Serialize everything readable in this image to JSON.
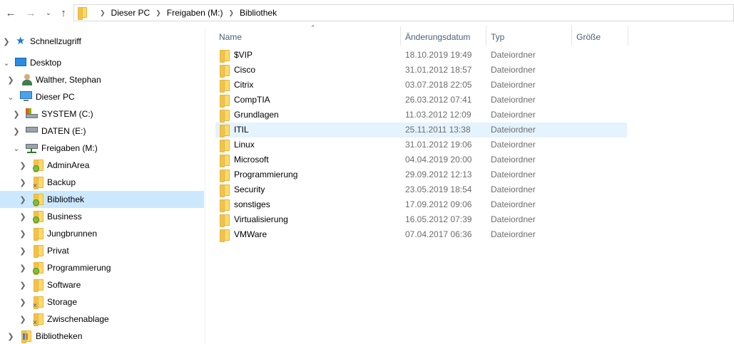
{
  "breadcrumb": [
    "Dieser PC",
    "Freigaben (M:)",
    "Bibliothek"
  ],
  "icons": {
    "back": "arrow-left-icon",
    "forward": "arrow-right-icon",
    "recent": "chevron-down-icon",
    "up": "arrow-up-icon"
  },
  "nav_tree": [
    {
      "label": "Schnellzugriff",
      "icon": "star-icon"
    },
    {
      "label": "Desktop",
      "icon": "desktop-icon"
    },
    {
      "label": "Walther, Stephan",
      "icon": "user-icon"
    },
    {
      "label": "Dieser PC",
      "icon": "computer-icon"
    },
    {
      "label": "SYSTEM (C:)",
      "icon": "system-drive-icon"
    },
    {
      "label": "DATEN (E:)",
      "icon": "drive-icon"
    },
    {
      "label": "Freigaben (M:)",
      "icon": "network-drive-icon"
    },
    {
      "label": "AdminArea",
      "icon": "shared-folder-icon"
    },
    {
      "label": "Backup",
      "icon": "offline-folder-icon"
    },
    {
      "label": "Bibliothek",
      "icon": "shared-folder-icon",
      "selected": true
    },
    {
      "label": "Business",
      "icon": "shared-folder-icon"
    },
    {
      "label": "Jungbrunnen",
      "icon": "folder-icon"
    },
    {
      "label": "Privat",
      "icon": "folder-icon"
    },
    {
      "label": "Programmierung",
      "icon": "shared-folder-icon"
    },
    {
      "label": "Software",
      "icon": "folder-icon"
    },
    {
      "label": "Storage",
      "icon": "offline-folder-icon"
    },
    {
      "label": "Zwischenablage",
      "icon": "offline-folder-icon"
    },
    {
      "label": "Bibliotheken",
      "icon": "libraries-icon"
    }
  ],
  "columns": {
    "name": "Name",
    "date": "Änderungsdatum",
    "type": "Typ",
    "size": "Größe"
  },
  "files": [
    {
      "name": "$VIP",
      "date": "18.10.2019 19:49",
      "type": "Dateiordner"
    },
    {
      "name": "Cisco",
      "date": "31.01.2012 18:57",
      "type": "Dateiordner"
    },
    {
      "name": "Citrix",
      "date": "03.07.2018 22:05",
      "type": "Dateiordner"
    },
    {
      "name": "CompTIA",
      "date": "26.03.2012 07:41",
      "type": "Dateiordner"
    },
    {
      "name": "Grundlagen",
      "date": "11.03.2012 12:09",
      "type": "Dateiordner"
    },
    {
      "name": "ITIL",
      "date": "25.11.2011 13:38",
      "type": "Dateiordner",
      "hover": true
    },
    {
      "name": "Linux",
      "date": "31.01.2012 19:06",
      "type": "Dateiordner"
    },
    {
      "name": "Microsoft",
      "date": "04.04.2019 20:00",
      "type": "Dateiordner"
    },
    {
      "name": "Programmierung",
      "date": "29.09.2012 12:13",
      "type": "Dateiordner"
    },
    {
      "name": "Security",
      "date": "23.05.2019 18:54",
      "type": "Dateiordner"
    },
    {
      "name": "sonstiges",
      "date": "17.09.2012 09:06",
      "type": "Dateiordner"
    },
    {
      "name": "Virtualisierung",
      "date": "16.05.2012 07:39",
      "type": "Dateiordner"
    },
    {
      "name": "VMWare",
      "date": "07.04.2017 06:36",
      "type": "Dateiordner"
    }
  ],
  "colors": {
    "selection": "#cce8ff",
    "hover": "#e5f3ff",
    "header_text": "#4c607a",
    "folder": "#ffd96a"
  }
}
